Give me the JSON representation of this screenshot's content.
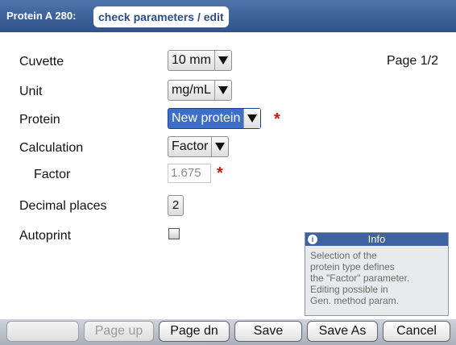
{
  "header": {
    "method": "Protein A 280:",
    "title": "check parameters / edit"
  },
  "page_indicator": "Page 1/2",
  "params": {
    "cuvette": {
      "label": "Cuvette",
      "value": "10 mm"
    },
    "unit": {
      "label": "Unit",
      "value": "mg/mL"
    },
    "protein": {
      "label": "Protein",
      "value": "New protein",
      "required_mark": "*"
    },
    "calculation": {
      "label": "Calculation",
      "value": "Factor"
    },
    "factor": {
      "label": "Factor",
      "value": "1.675",
      "required_mark": "*"
    },
    "decimal_places": {
      "label": "Decimal places",
      "value": "2"
    },
    "autoprint": {
      "label": "Autoprint",
      "checked": false
    }
  },
  "info": {
    "title": "Info",
    "icon": "info-icon",
    "lines": [
      "Selection of the",
      "protein type defines",
      "the \"Factor\" parameter.",
      "Editing possible in",
      "Gen. method param."
    ]
  },
  "footer": {
    "blank": "",
    "page_up": "Page up",
    "page_dn": "Page dn",
    "save": "Save",
    "save_as": "Save As",
    "cancel": "Cancel"
  },
  "colors": {
    "title_bar": "#2e5289",
    "selection": "#3d6fc9",
    "required_star": "#d81010"
  }
}
